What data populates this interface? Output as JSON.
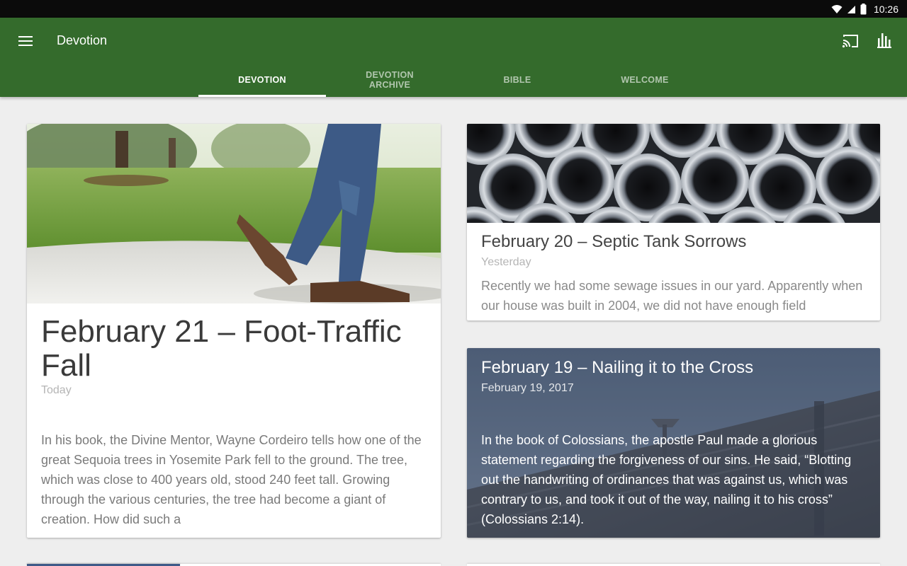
{
  "status_bar": {
    "time": "10:26"
  },
  "app_bar": {
    "title": "Devotion",
    "background": "#346b2c",
    "icons": [
      "menu-icon",
      "cast-icon",
      "bar-chart-icon"
    ]
  },
  "tabs": [
    {
      "label": "DEVOTION",
      "active": true
    },
    {
      "label": "DEVOTION ARCHIVE",
      "active": false
    },
    {
      "label": "BIBLE",
      "active": false
    },
    {
      "label": "WELCOME",
      "active": false
    }
  ],
  "cards": {
    "featured": {
      "title": "February 21 – Foot-Traffic Fall",
      "date": "Today",
      "excerpt": "In his book, the Divine Mentor, Wayne Cordeiro tells how one of the great Sequoia trees in Yosemite Park fell to the ground.  The tree, which was close to 400 years old, stood 240 feet tall.  Growing through the various centuries, the tree had become a giant of creation.  How did such a",
      "image": "walking-feet-photo"
    },
    "second": {
      "title": "February 20 – Septic Tank Sorrows",
      "date": "Yesterday",
      "excerpt": "Recently we had some sewage issues in our yard.  Apparently when our house was built in 2004, we did not have enough field",
      "image": "pipes-photo"
    },
    "third": {
      "title": "February 19 – Nailing it to the Cross",
      "date": "February 19, 2017",
      "excerpt": "In the book of Colossians, the apostle Paul made a glorious statement regarding the forgiveness of our sins. He said, “Blotting out the handwriting of ordinances that was against us, which was contrary to us, and took it out of the way, nailing it to his cross” (Colossians 2:14).",
      "image": "nail-in-wood-photo"
    }
  }
}
